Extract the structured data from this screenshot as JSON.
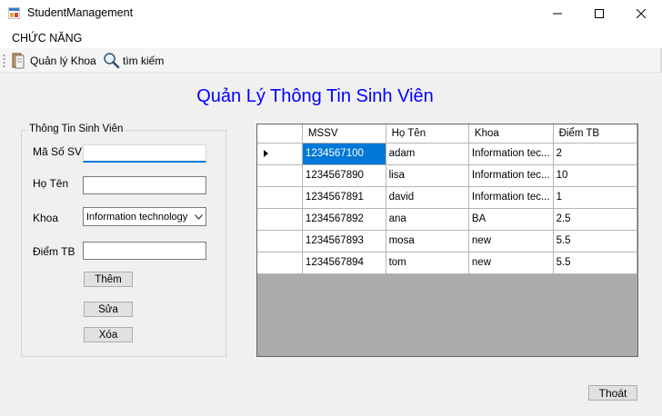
{
  "window": {
    "title": "StudentManagement",
    "icon": "app-form-icon"
  },
  "menu": {
    "items": [
      {
        "label": "CHỨC NĂNG"
      }
    ]
  },
  "toolbar": {
    "items": [
      {
        "label": "Quản lý Khoa",
        "icon": "book-icon"
      },
      {
        "label": "tìm kiếm",
        "icon": "magnifier-icon"
      }
    ]
  },
  "heading": "Quản Lý Thông Tin Sinh Viên",
  "form": {
    "group_title": "Thông Tin Sinh Viên",
    "mssv_label": "Mã Số SV",
    "mssv_value": "",
    "name_label": "Họ Tên",
    "name_value": "",
    "faculty_label": "Khoa",
    "faculty_value": "Information technology",
    "gpa_label": "Điểm TB",
    "gpa_value": "",
    "add_label": "Thêm",
    "edit_label": "Sửa",
    "delete_label": "Xóa"
  },
  "grid": {
    "columns": [
      "MSSV",
      "Họ Tên",
      "Khoa",
      "Điểm TB"
    ],
    "rows": [
      {
        "mssv": "1234567100",
        "name": "adam",
        "faculty": "Information tec...",
        "gpa": "2"
      },
      {
        "mssv": "1234567890",
        "name": "lisa",
        "faculty": "Information tec...",
        "gpa": "10"
      },
      {
        "mssv": "1234567891",
        "name": "david",
        "faculty": "Information tec...",
        "gpa": "1"
      },
      {
        "mssv": "1234567892",
        "name": "ana",
        "faculty": "BA",
        "gpa": "2.5"
      },
      {
        "mssv": "1234567893",
        "name": "mosa",
        "faculty": "new",
        "gpa": "5.5"
      },
      {
        "mssv": "1234567894",
        "name": "tom",
        "faculty": "new",
        "gpa": "5.5"
      }
    ]
  },
  "exit_label": "Thoát",
  "colors": {
    "heading": "#0000ff",
    "selection": "#0078d7",
    "grid_background": "#ababab"
  }
}
